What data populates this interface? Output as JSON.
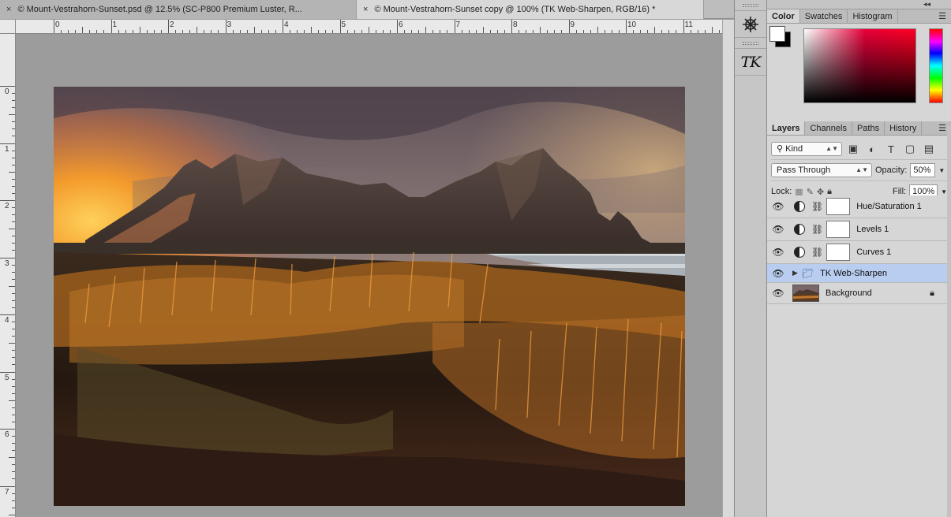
{
  "tabs": [
    {
      "close": "×",
      "title": "© Mount-Vestrahorn-Sunset.psd @ 12.5% (SC-P800 Premium Luster, R..."
    },
    {
      "close": "×",
      "title": "© Mount-Vestrahorn-Sunset copy @ 100% (TK Web-Sharpen, RGB/16) *"
    }
  ],
  "ruler": {
    "h_labels": [
      "0",
      "1",
      "2",
      "3",
      "4",
      "5",
      "6",
      "7",
      "8",
      "9",
      "10",
      "11"
    ],
    "v_labels": [
      "0",
      "1",
      "2",
      "3",
      "4",
      "5",
      "6",
      "7"
    ]
  },
  "toolstrip": {
    "tool1_icon": "compass-wheel-icon",
    "tool2_label": "TK"
  },
  "color_panel": {
    "collapse": "◂◂",
    "tabs": [
      "Color",
      "Swatches",
      "Histogram"
    ],
    "menu": "☰",
    "foreground": "#ffffff",
    "background": "#000000"
  },
  "layers_panel": {
    "tabs": [
      "Layers",
      "Channels",
      "Paths",
      "History"
    ],
    "menu": "☰",
    "filter_kind": "Kind",
    "blend_mode": "Pass Through",
    "opacity_label": "Opacity:",
    "opacity_value": "50%",
    "lock_label": "Lock:",
    "fill_label": "Fill:",
    "fill_value": "100%",
    "layers": [
      {
        "name": "Hue/Saturation 1",
        "type": "adjustment"
      },
      {
        "name": "Levels 1",
        "type": "adjustment"
      },
      {
        "name": "Curves 1",
        "type": "adjustment"
      },
      {
        "name": "TK Web-Sharpen",
        "type": "group",
        "selected": true
      },
      {
        "name": "Background",
        "type": "background",
        "locked": true
      }
    ]
  }
}
